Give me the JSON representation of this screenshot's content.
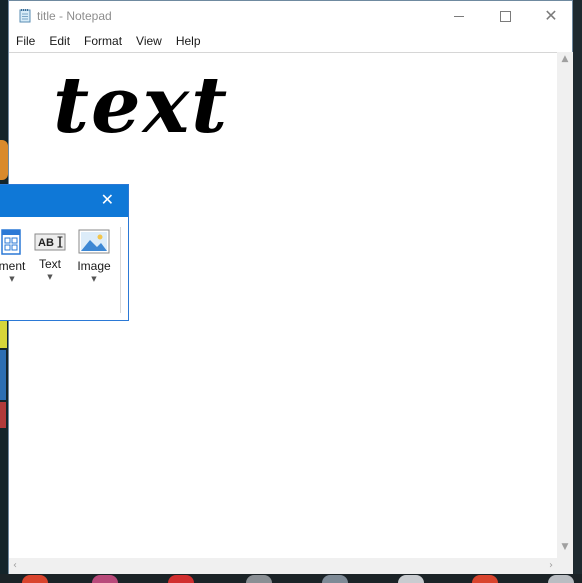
{
  "window": {
    "title": "title - Notepad",
    "icon": "notepad-icon"
  },
  "controls": {
    "minimize_icon": "minimize-icon",
    "maximize_icon": "maximize-icon",
    "close_icon": "close-icon",
    "close_glyph": "✕"
  },
  "menu": {
    "items": [
      {
        "label": "File"
      },
      {
        "label": "Edit"
      },
      {
        "label": "Format"
      },
      {
        "label": "View"
      },
      {
        "label": "Help"
      }
    ]
  },
  "editor": {
    "content": "text"
  },
  "insert_toolbar": {
    "close_glyph": "✕",
    "tools": [
      {
        "label": "ment",
        "icon": "document-layout-icon"
      },
      {
        "label": "Text",
        "icon": "text-box-icon"
      },
      {
        "label": "Image",
        "icon": "image-icon"
      }
    ],
    "accent": "#0f78d7"
  },
  "colors": {
    "titlebar_text": "#8d8d8d",
    "accent": "#0f78d7",
    "window_border": "#6f8aa0"
  }
}
